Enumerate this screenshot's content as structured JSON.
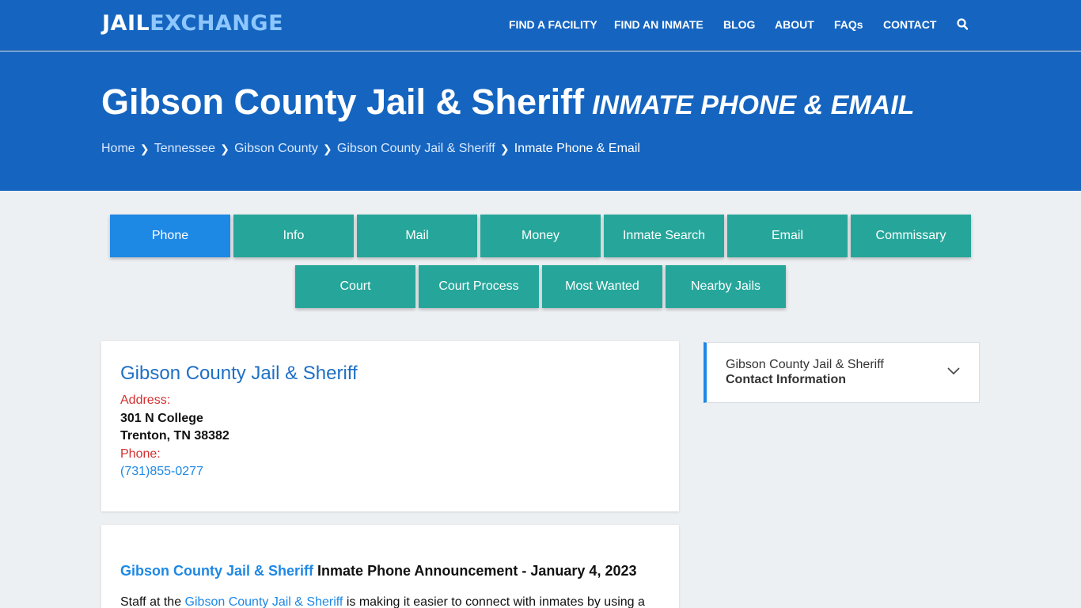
{
  "logo": {
    "part1": "JAIL",
    "part2": "EXCHANGE"
  },
  "nav": [
    {
      "label": "FIND A FACILITY"
    },
    {
      "label": "FIND AN INMATE"
    },
    {
      "label": "BLOG"
    },
    {
      "label": "ABOUT"
    },
    {
      "label": "FAQs"
    },
    {
      "label": "CONTACT"
    }
  ],
  "hero": {
    "title": "Gibson County Jail & Sheriff",
    "subtitle": "INMATE PHONE & EMAIL",
    "breadcrumb": [
      "Home",
      "Tennessee",
      "Gibson County",
      "Gibson County Jail & Sheriff",
      "Inmate Phone & Email"
    ]
  },
  "tabs": {
    "row1": [
      "Phone",
      "Info",
      "Mail",
      "Money",
      "Inmate Search",
      "Email",
      "Commissary"
    ],
    "row2": [
      "Court",
      "Court Process",
      "Most Wanted",
      "Nearby Jails"
    ],
    "active": "Phone"
  },
  "facility": {
    "name": "Gibson County Jail & Sheriff",
    "address_label": "Address:",
    "address_line1": "301 N College",
    "address_line2": "Trenton, TN 38382",
    "phone_label": "Phone:",
    "phone": "(731)855-0277"
  },
  "announcement": {
    "link": "Gibson County Jail & Sheriff",
    "title": "Inmate Phone Announcement - January 4, 2023",
    "body_prefix": "Staff at the",
    "body_link": "Gibson County Jail & Sheriff",
    "body_suffix": "is making it easier to connect with inmates by using a"
  },
  "sidebar": {
    "line1": "Gibson County Jail & Sheriff",
    "line2": "Contact Information"
  },
  "colors": {
    "header_blue": "#1565c0",
    "tab_teal": "#26a69a",
    "tab_active": "#1e88e5",
    "link_blue": "#1e88e5",
    "label_red": "#d32f2f"
  }
}
